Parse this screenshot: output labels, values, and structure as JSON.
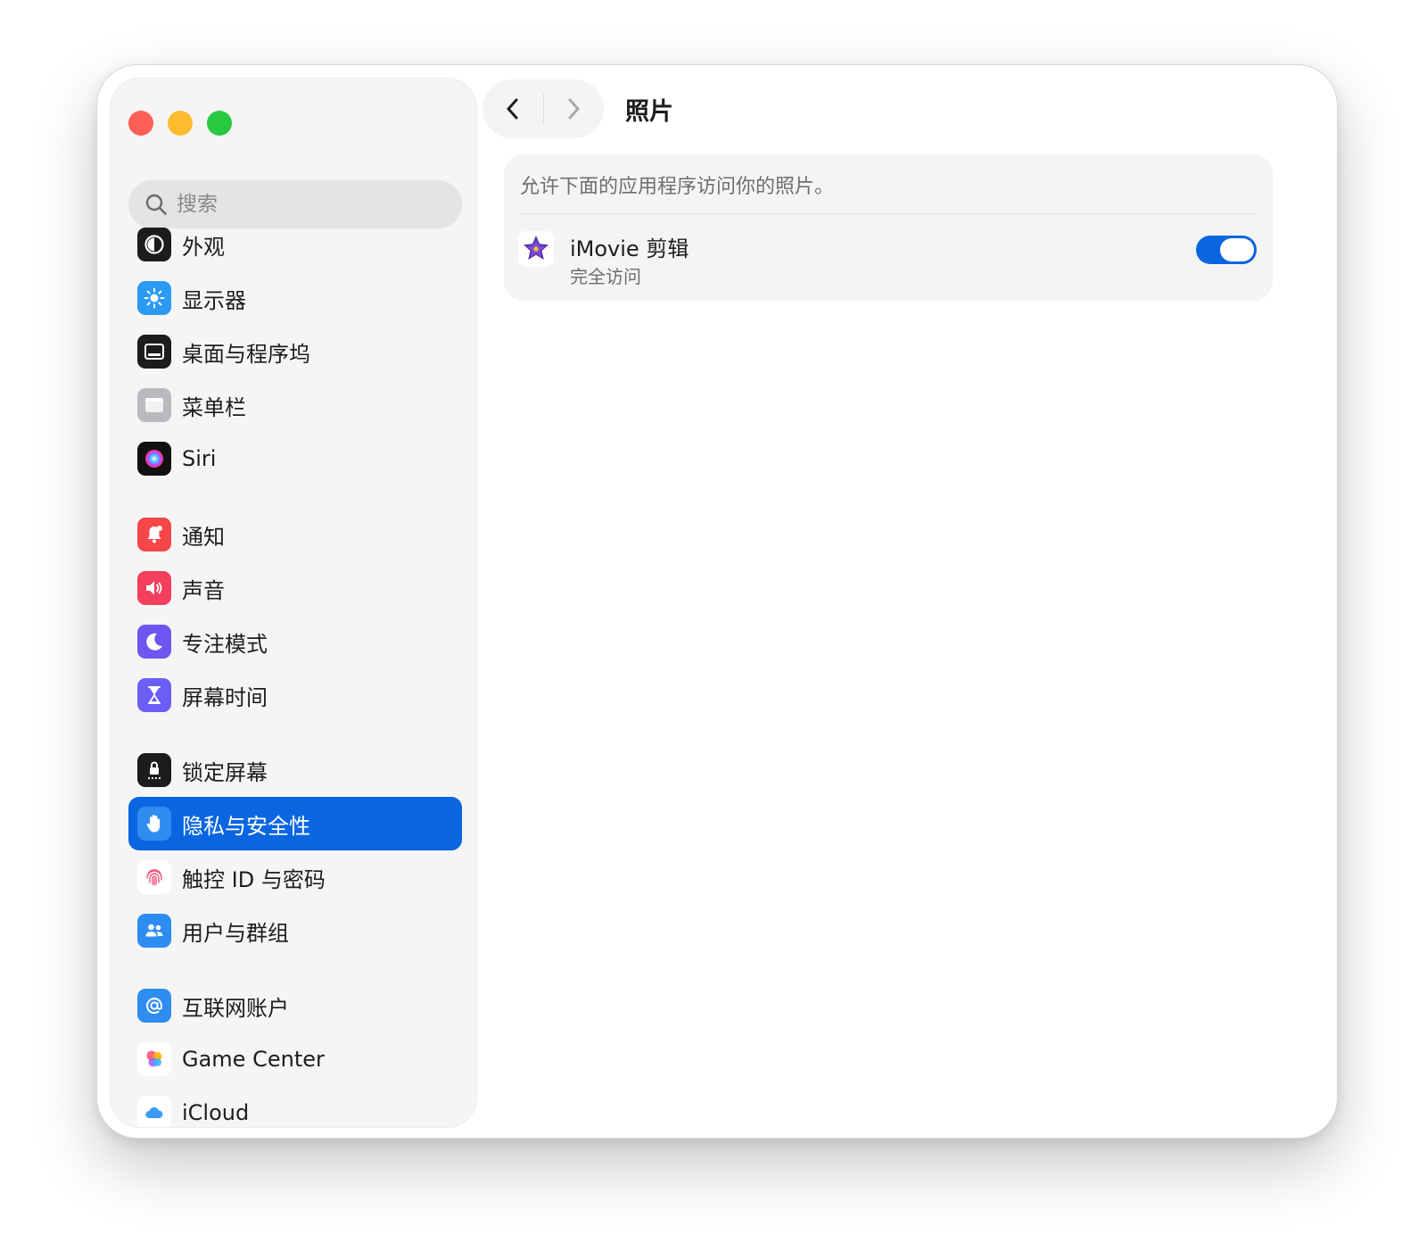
{
  "sidebar": {
    "search": {
      "placeholder": "搜索"
    },
    "items": [
      {
        "label": "外观",
        "icon": "appearance-icon"
      },
      {
        "label": "显示器",
        "icon": "display-icon"
      },
      {
        "label": "桌面与程序坞",
        "icon": "desktop-dock-icon"
      },
      {
        "label": "菜单栏",
        "icon": "menu-bar-icon"
      },
      {
        "label": "Siri",
        "icon": "siri-icon"
      },
      {
        "label": "通知",
        "icon": "notifications-icon"
      },
      {
        "label": "声音",
        "icon": "sound-icon"
      },
      {
        "label": "专注模式",
        "icon": "focus-icon"
      },
      {
        "label": "屏幕时间",
        "icon": "screen-time-icon"
      },
      {
        "label": "锁定屏幕",
        "icon": "lock-screen-icon"
      },
      {
        "label": "隐私与安全性",
        "icon": "privacy-hand-icon",
        "selected": true
      },
      {
        "label": "触控 ID 与密码",
        "icon": "touch-id-icon"
      },
      {
        "label": "用户与群组",
        "icon": "users-groups-icon"
      },
      {
        "label": "互联网账户",
        "icon": "internet-accounts-icon"
      },
      {
        "label": "Game Center",
        "icon": "game-center-icon"
      },
      {
        "label": "iCloud",
        "icon": "icloud-icon"
      }
    ]
  },
  "toolbar": {
    "title": "照片"
  },
  "main": {
    "description": "允许下面的应用程序访问你的照片。",
    "apps": [
      {
        "name": "iMovie 剪辑",
        "access": "完全访问",
        "enabled": true,
        "icon": "imovie-star-icon"
      }
    ]
  },
  "colors": {
    "accent": "#0a66e0",
    "traffic_red": "#fe5f57",
    "traffic_yellow": "#febc2e",
    "traffic_green": "#28c840"
  }
}
